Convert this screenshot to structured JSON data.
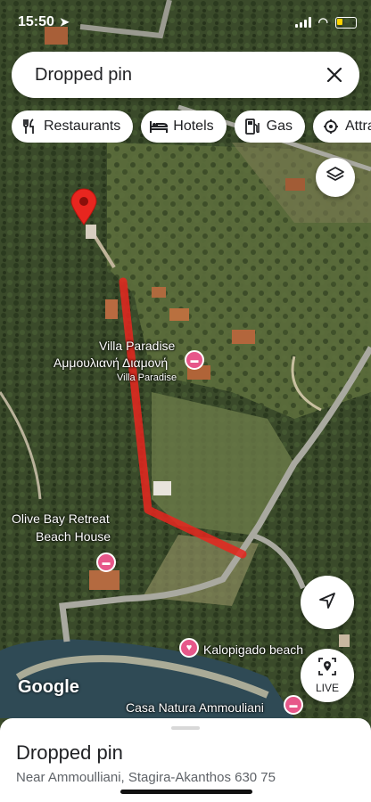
{
  "status_bar": {
    "time": "15:50",
    "location_icon": "location-arrow-icon"
  },
  "search": {
    "value": "Dropped pin",
    "clear_icon": "close-icon"
  },
  "chips": [
    {
      "label": "Restaurants",
      "icon": "fork-knife-icon"
    },
    {
      "label": "Hotels",
      "icon": "bed-icon"
    },
    {
      "label": "Gas",
      "icon": "gas-pump-icon"
    },
    {
      "label": "Attra",
      "icon": "attraction-icon"
    }
  ],
  "map": {
    "places": {
      "villa_paradise_line1": "Villa Paradise",
      "villa_paradise_line2": "Αμμουλιανή Διαμονή",
      "villa_paradise_sub": "Villa Paradise",
      "olive_bay_line1": "Olive Bay Retreat",
      "olive_bay_line2": "Beach House",
      "kalopigado": "Kalopigado beach",
      "casa_natura": "Casa Natura Ammouliani"
    },
    "route_color": "#e8261f",
    "pin_color": "#e8261f",
    "hotel_badge_color": "#e7578a",
    "attribution": "Google"
  },
  "buttons": {
    "live_label": "LIVE"
  },
  "sheet": {
    "title": "Dropped pin",
    "address": "Near Ammoulliani, Stagira-Akanthos 630 75"
  }
}
